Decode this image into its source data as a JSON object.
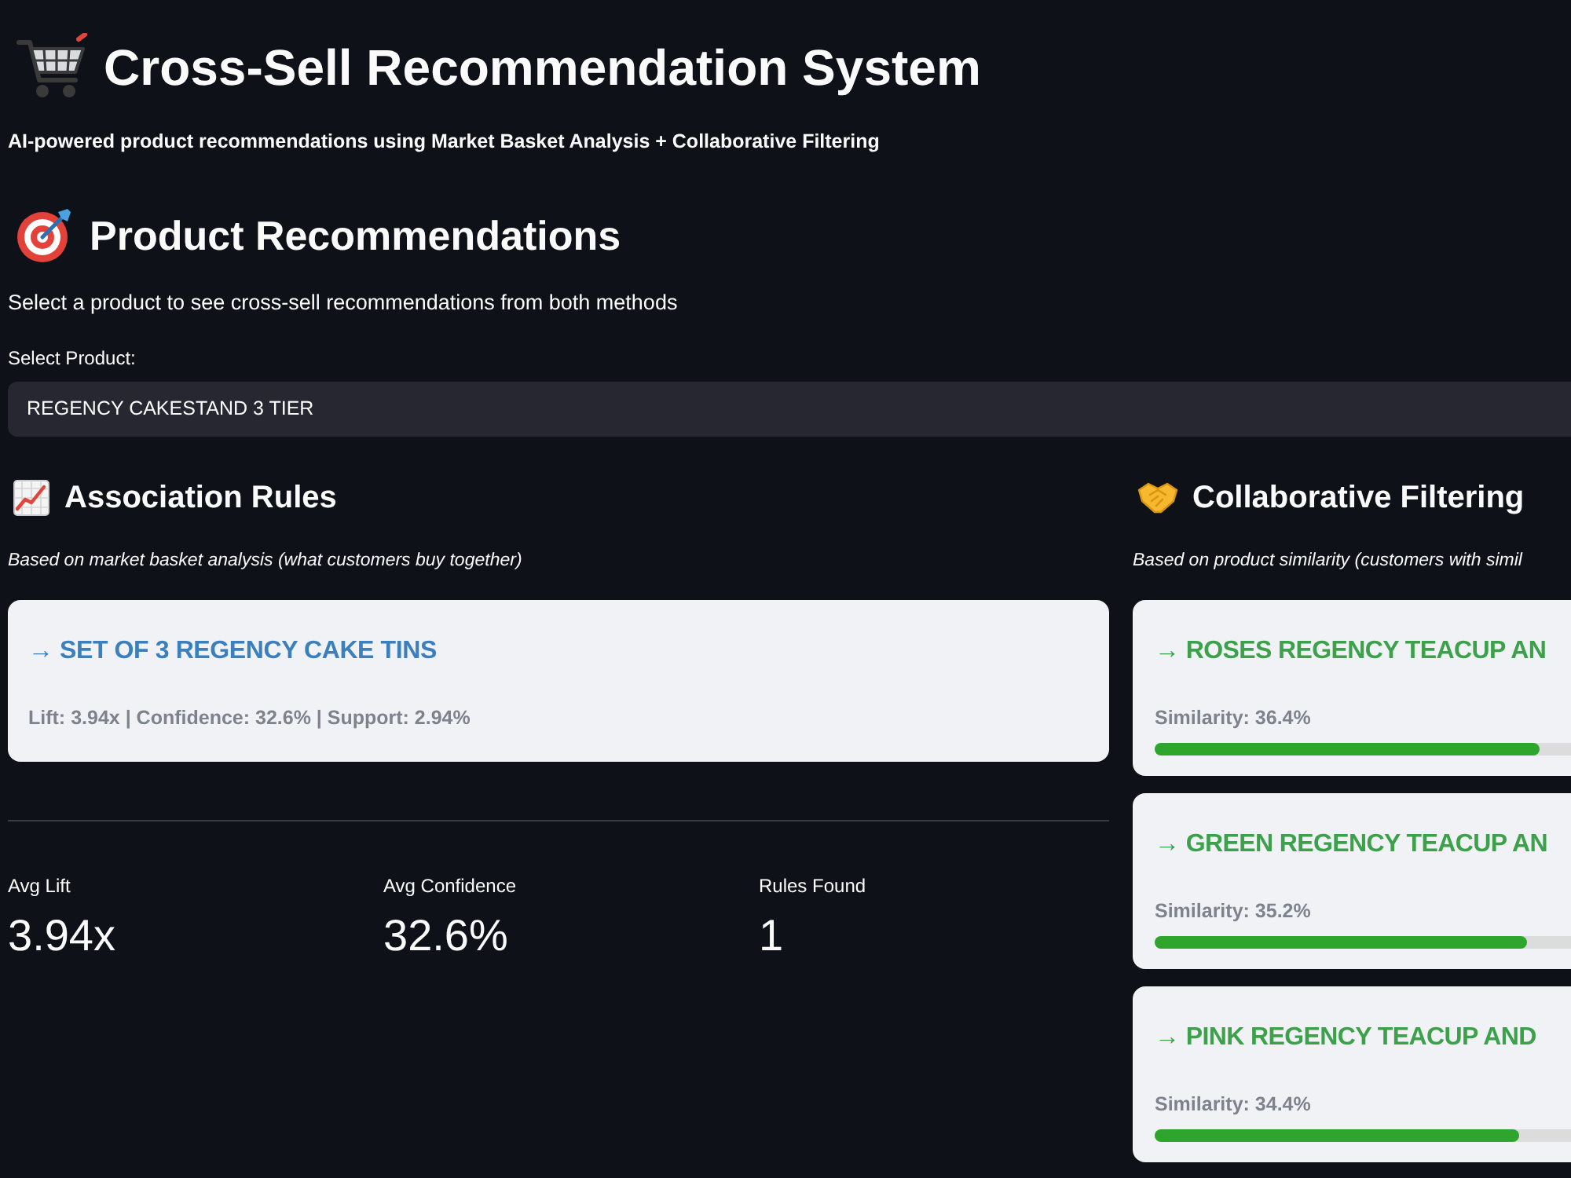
{
  "header": {
    "title": "Cross-Sell Recommendation System",
    "subtitle": "AI-powered product recommendations using Market Basket Analysis + Collaborative Filtering"
  },
  "product_recommendations": {
    "title": "Product Recommendations",
    "description": "Select a product to see cross-sell recommendations from both methods",
    "select": {
      "label": "Select Product:",
      "value": "REGENCY CAKESTAND 3 TIER"
    }
  },
  "association_rules": {
    "title": "Association Rules",
    "description": "Based on market basket analysis (what customers buy together)",
    "recommendations": [
      {
        "title": "→ SET OF 3 REGENCY CAKE TINS",
        "stats": "Lift: 3.94x | Confidence: 32.6% | Support: 2.94%"
      }
    ],
    "metrics": [
      {
        "label": "Avg Lift",
        "value": "3.94x"
      },
      {
        "label": "Avg Confidence",
        "value": "32.6%"
      },
      {
        "label": "Rules Found",
        "value": "1"
      }
    ]
  },
  "collaborative_filtering": {
    "title": "Collaborative Filtering",
    "description": "Based on product similarity (customers with simil",
    "recommendations": [
      {
        "title": "→ ROSES REGENCY TEACUP AN",
        "similarity": "Similarity: 36.4%",
        "level": 0.364
      },
      {
        "title": "→ GREEN REGENCY TEACUP AN",
        "similarity": "Similarity: 35.2%",
        "level": 0.352
      },
      {
        "title": "→ PINK REGENCY TEACUP AND",
        "similarity": "Similarity: 34.4%",
        "level": 0.344
      }
    ]
  }
}
